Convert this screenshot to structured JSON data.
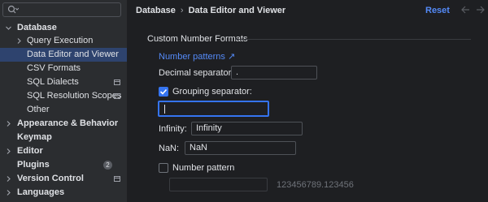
{
  "search": {
    "value": ""
  },
  "sidebar": {
    "items": [
      {
        "label": "Database",
        "bold": true
      },
      {
        "label": "Query Execution"
      },
      {
        "label": "Data Editor and Viewer"
      },
      {
        "label": "CSV Formats"
      },
      {
        "label": "SQL Dialects"
      },
      {
        "label": "SQL Resolution Scopes"
      },
      {
        "label": "Other"
      },
      {
        "label": "Appearance & Behavior",
        "bold": true
      },
      {
        "label": "Keymap",
        "bold": true
      },
      {
        "label": "Editor",
        "bold": true
      },
      {
        "label": "Plugins",
        "bold": true,
        "badge": "2"
      },
      {
        "label": "Version Control",
        "bold": true
      },
      {
        "label": "Languages",
        "bold": true
      }
    ]
  },
  "header": {
    "breadcrumb": [
      "Database",
      "Data Editor and Viewer"
    ],
    "reset_label": "Reset"
  },
  "content": {
    "section_title": "Custom Number Formats",
    "number_patterns_link": "Number patterns ↗",
    "decimal_separator": {
      "label": "Decimal separator:",
      "value": "."
    },
    "grouping_separator": {
      "label": "Grouping separator:",
      "checked": true,
      "value": ""
    },
    "infinity": {
      "label": "Infinity:",
      "value": "Infinity"
    },
    "nan": {
      "label": "NaN:",
      "value": "NaN"
    },
    "number_pattern": {
      "label": "Number pattern",
      "checked": false,
      "value": ""
    },
    "sample": "123456789.123456"
  },
  "colors": {
    "background": "#1e1f22",
    "sidebar": "#2b2d30",
    "selection": "#2e436e",
    "accent": "#548af7",
    "checkbox": "#3574f0"
  }
}
